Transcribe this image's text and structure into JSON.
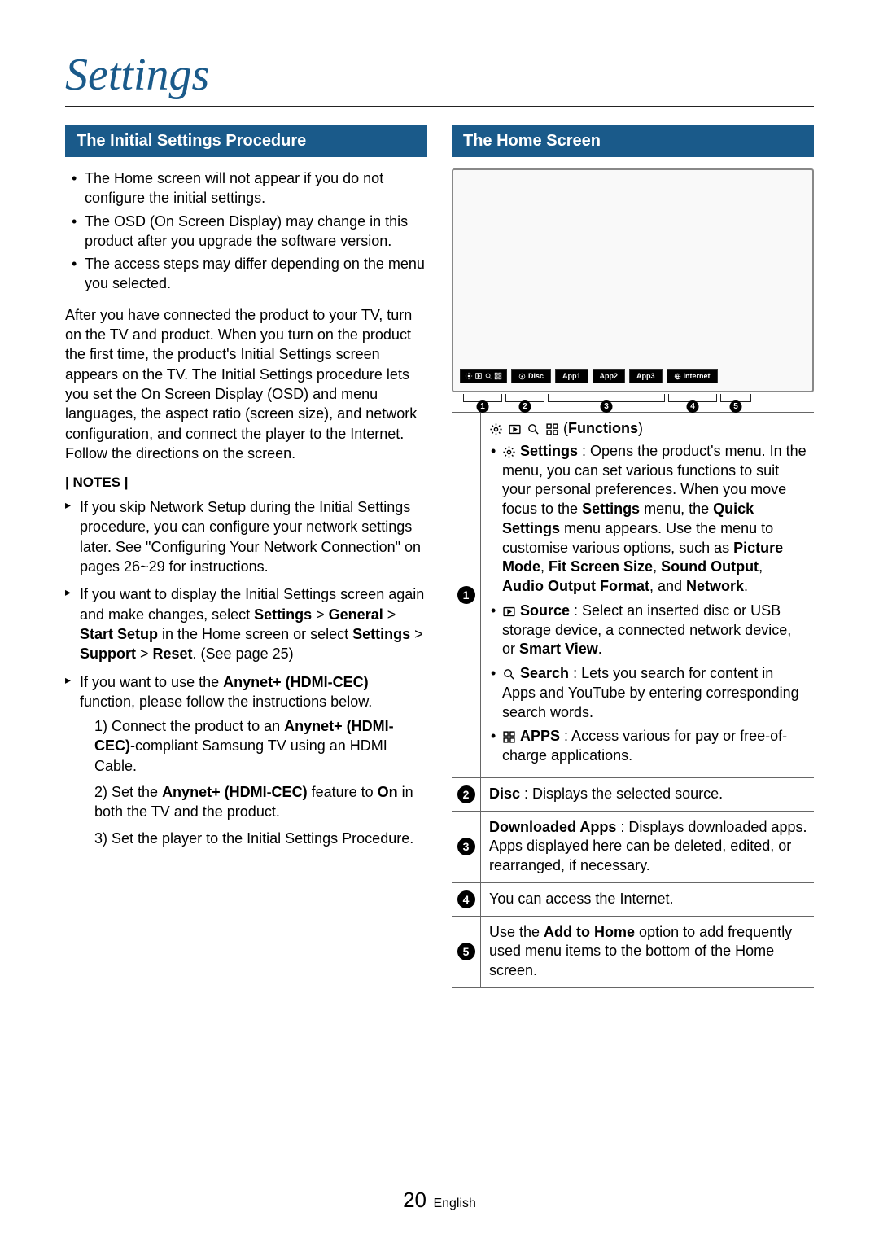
{
  "page": {
    "title": "Settings",
    "number": "20",
    "language": "English"
  },
  "left": {
    "header": "The Initial Settings Procedure",
    "bullets": [
      "The Home screen will not appear if you do not configure the initial settings.",
      "The OSD (On Screen Display) may change in this product after you upgrade the software version.",
      "The access steps may differ depending on the menu you selected."
    ],
    "paragraph": "After you have connected the product to your TV, turn on the TV and product. When you turn on the product the first time, the product's Initial Settings screen appears on the TV. The Initial Settings procedure lets you set the On Screen Display (OSD) and menu languages, the aspect ratio (screen size), and network configuration, and connect the player to the Internet. Follow the directions on the screen.",
    "notes_label": "| NOTES |",
    "notes": {
      "n1": "If you skip Network Setup during the Initial Settings procedure, you can configure your network settings later. See \"Configuring Your Network Connection\" on pages 26~29 for instructions.",
      "n2_a": "If you want to display the Initial Settings screen again and make changes, select ",
      "n2_b": "Settings",
      "n2_c": " > ",
      "n2_d": "General",
      "n2_e": " > ",
      "n2_f": "Start Setup",
      "n2_g": " in the Home screen or select ",
      "n2_h": "Settings",
      "n2_i": " > ",
      "n2_j": "Support",
      "n2_k": " > ",
      "n2_l": "Reset",
      "n2_m": ". (See page 25)",
      "n3_a": "If you want to use the ",
      "n3_b": "Anynet+ (HDMI-CEC)",
      "n3_c": " function, please follow the instructions below.",
      "s1_a": "1) Connect the product to an ",
      "s1_b": "Anynet+ (HDMI-CEC)",
      "s1_c": "-compliant Samsung TV using an HDMI Cable.",
      "s2_a": "2) Set the ",
      "s2_b": "Anynet+ (HDMI-CEC)",
      "s2_c": " feature to ",
      "s2_d": "On",
      "s2_e": " in both the TV and the product.",
      "s3": "3) Set the player to the Initial Settings Procedure."
    }
  },
  "right": {
    "header": "The Home Screen",
    "taskbar": {
      "disc": "Disc",
      "app1": "App1",
      "app2": "App2",
      "app3": "App3",
      "internet": "Internet"
    },
    "legend": {
      "functions_label": "Functions",
      "r1": {
        "settings_b": "Settings",
        "settings_t": " : Opens the product's menu. In the menu, you can set various functions to suit your personal preferences. When you move focus to the ",
        "settings_m": "Settings",
        "settings_t2": " menu, the ",
        "quick_b": "Quick Settings",
        "settings_t3": " menu appears. Use the menu to customise various options, such as ",
        "pm": "Picture Mode",
        "comma1": ", ",
        "fss": "Fit Screen Size",
        "comma2": ", ",
        "so": "Sound Output",
        "comma3": ", ",
        "aof": "Audio Output Format",
        "and": ", and ",
        "net": "Network",
        "dot": ".",
        "source_b": "Source",
        "source_t1": " : Select an inserted disc or USB storage device, a connected network device, or ",
        "sv": "Smart View",
        "source_t2": ".",
        "search_b": "Search",
        "search_t": " : Lets you search for content in Apps and YouTube by entering corresponding search words.",
        "apps_b": "APPS",
        "apps_t": " : Access various for pay or free-of-charge applications."
      },
      "r2_b": "Disc",
      "r2_t": " : Displays the selected source.",
      "r3_b": "Downloaded Apps",
      "r3_t": " : Displays downloaded apps. Apps displayed here can be deleted, edited, or rearranged, if necessary.",
      "r4": "You can access the Internet.",
      "r5_a": "Use the ",
      "r5_b": "Add to Home",
      "r5_c": " option to add frequently used menu items to the bottom of the Home screen."
    }
  }
}
